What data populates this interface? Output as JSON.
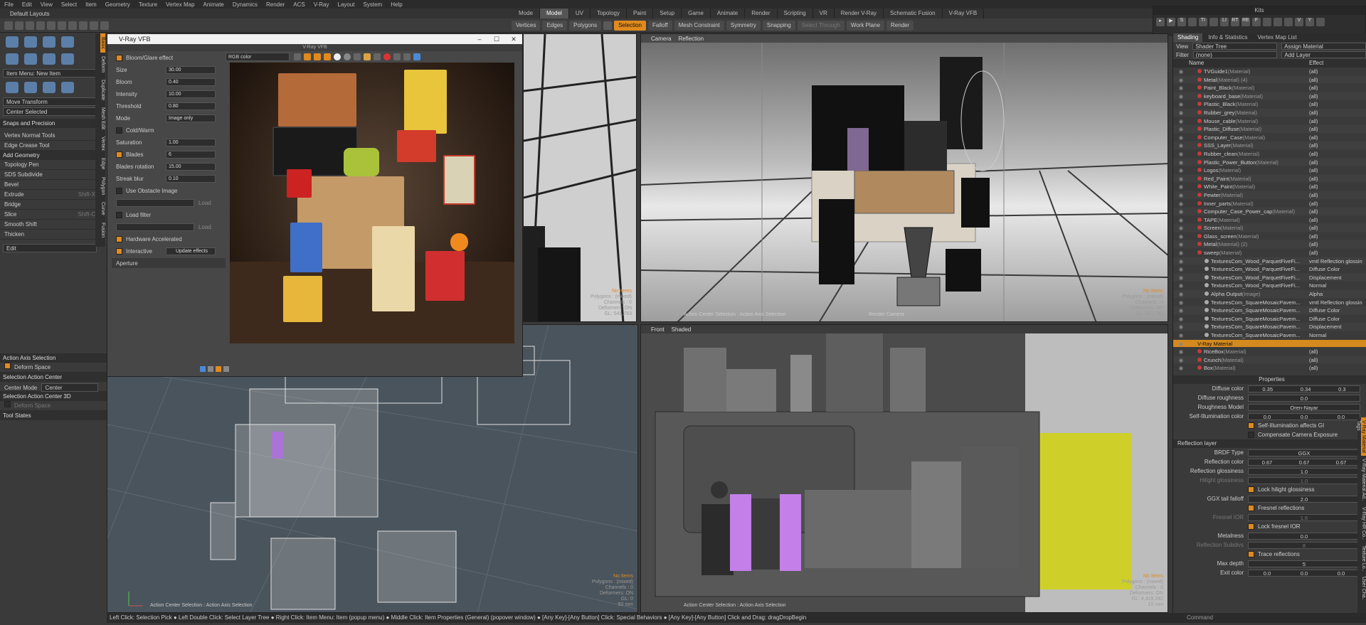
{
  "menu": [
    "File",
    "Edit",
    "View",
    "Select",
    "Item",
    "Geometry",
    "Texture",
    "Vertex Map",
    "Animate",
    "Dynamics",
    "Render",
    "ACS",
    "V-Ray",
    "Layout",
    "System",
    "Help"
  ],
  "layout_label": "Default Layouts",
  "layout_tabs": [
    "Mode",
    "Model",
    "UV",
    "Topology",
    "Paint",
    "Setup",
    "Game",
    "Animate",
    "Render",
    "Scripting",
    "VR",
    "Render V-Ray",
    "Schematic Fusion",
    "V-Ray VFB"
  ],
  "toolbar": {
    "vertices": "Vertices",
    "edges": "Edges",
    "polygons": "Polygons",
    "selection": "Selection",
    "falloff": "Falloff",
    "mesh_constraint": "Mesh Constraint",
    "symmetry": "Symmetry",
    "snapping": "Snapping",
    "select_through": "Select Through",
    "work_plane": "Work Plane",
    "render": "Render"
  },
  "kits": {
    "title": "Kits"
  },
  "left": {
    "item_menu": "Item Menu: New Item",
    "move_transform": "Move Transform",
    "center_selected": "Center Selected",
    "snaps": "Snaps and Precision",
    "vertex_normal": "Vertex Normal Tools",
    "edge_crease": "Edge Crease Tool",
    "add_geometry": "Add Geometry",
    "tools": [
      {
        "name": "Topology Pen",
        "key": ""
      },
      {
        "name": "SDS Subdivide",
        "key": ""
      },
      {
        "name": "Bevel",
        "key": ""
      },
      {
        "name": "Extrude",
        "key": "Shift-X"
      },
      {
        "name": "Bridge",
        "key": ""
      },
      {
        "name": "Slice",
        "key": "Shift-C"
      },
      {
        "name": "Smooth Shift",
        "key": ""
      },
      {
        "name": "Thicken",
        "key": ""
      }
    ],
    "edit": "Edit",
    "action_axis": "Action Axis Selection",
    "deform_space": "Deform Space",
    "sel_action_center": "Selection Action Center",
    "center_mode_label": "Center Mode",
    "center_mode_value": "Center",
    "sel_action_center_3d": "Selection Action Center 3D",
    "deform_space2": "Deform Space",
    "tool_states": "Tool States"
  },
  "sidetabs": [
    "Basic",
    "Deform",
    "Duplicate",
    "Mesh Edit",
    "Vertex",
    "Edge",
    "Polygon",
    "Curve",
    "Fusion"
  ],
  "vfb": {
    "window_title": "V-Ray VFB",
    "sub_title": "V-Ray VFB",
    "channel": "RGB color",
    "bloom_label": "Bloom/Glare effect",
    "size_label": "Size",
    "size": "30.00",
    "bloom": "Bloom",
    "bloom_val": "0.40",
    "intensity": "Intensity",
    "intensity_val": "10.00",
    "threshold": "Threshold",
    "threshold_val": "0.80",
    "mode": "Mode",
    "mode_val": "Image only",
    "cold_warm": "Cold/Warm",
    "saturation": "Saturation",
    "saturation_val": "1.00",
    "blades": "Blades",
    "blades_val": "6",
    "blades_rot": "Blades rotation",
    "blades_rot_val": "15.00",
    "streak": "Streak blur",
    "streak_val": "0.10",
    "obstacle": "Use Obstacle Image",
    "load": "Load",
    "load_filter": "Load filter",
    "load2": "Load",
    "hw": "Hardware Accelerated",
    "interactive": "Interactive",
    "update_effects": "Update effects",
    "aperture": "Aperture"
  },
  "vp_tl": {
    "info": [
      "No Items",
      "Polygons : (mixed)",
      "Channels : 0",
      "Deformers: ON",
      "GL: 541,783"
    ]
  },
  "vp_tr": {
    "camera": "Camera",
    "reflection": "Reflection",
    "info": [
      "No Items",
      "Polygons : (mixed)",
      "Channels : 0",
      "Deformers: ON",
      "GL: 541,783"
    ],
    "bottom": "Action Center Selection : Action Axis Selection",
    "render_camera": "Render Camera"
  },
  "vp_bl": {
    "info": [
      "No Items",
      "Polygons : (mixed)",
      "Channels : 0",
      "Deformers: ON",
      "GL: 0",
      "50 mm"
    ],
    "bottom": "Action Center Selection : Action Axis Selection"
  },
  "vp_br": {
    "front": "Front",
    "shaded": "Shaded",
    "info": [
      "No Items",
      "Polygons : (mixed)",
      "Channels : 0",
      "Deformers: ON",
      "GL: 4,419,242",
      "10 mm"
    ],
    "bottom": "Action Center Selection : Action Axis Selection"
  },
  "right": {
    "tabs": [
      "Shading",
      "Info & Statistics",
      "Vertex Map List"
    ],
    "view_label": "View",
    "view_value": "Shader Tree",
    "assign": "Assign Material",
    "filter_label": "Filter",
    "filter_value": "(none)",
    "add_layer": "Add Layer",
    "col_name": "Name",
    "col_effect": "Effect",
    "rows": [
      {
        "n": "TVGuide1",
        "t": "(Material)",
        "e": "(all)",
        "k": "r"
      },
      {
        "n": "Metal",
        "t": "(Material) (4)",
        "e": "(all)",
        "k": "r"
      },
      {
        "n": "Paint_Black",
        "t": "(Material)",
        "e": "(all)",
        "k": "r"
      },
      {
        "n": "keyboard_base",
        "t": "(Material)",
        "e": "(all)",
        "k": "r"
      },
      {
        "n": "Plastic_Black",
        "t": "(Material)",
        "e": "(all)",
        "k": "r"
      },
      {
        "n": "Rubber_grey",
        "t": "(Material)",
        "e": "(all)",
        "k": "r"
      },
      {
        "n": "Mouse_cable",
        "t": "(Material)",
        "e": "(all)",
        "k": "r"
      },
      {
        "n": "Plastic_Diffuse",
        "t": "(Material)",
        "e": "(all)",
        "k": "r"
      },
      {
        "n": "Computer_Case",
        "t": "(Material)",
        "e": "(all)",
        "k": "r"
      },
      {
        "n": "SSS_Layer",
        "t": "(Material)",
        "e": "(all)",
        "k": "r"
      },
      {
        "n": "Rubber_clean",
        "t": "(Material)",
        "e": "(all)",
        "k": "r"
      },
      {
        "n": "Plastic_Power_Button",
        "t": "(Material)",
        "e": "(all)",
        "k": "r"
      },
      {
        "n": "Logos",
        "t": "(Material)",
        "e": "(all)",
        "k": "r"
      },
      {
        "n": "Red_Paint",
        "t": "(Material)",
        "e": "(all)",
        "k": "r"
      },
      {
        "n": "White_Paint",
        "t": "(Material)",
        "e": "(all)",
        "k": "r"
      },
      {
        "n": "Pewter",
        "t": "(Material)",
        "e": "(all)",
        "k": "r"
      },
      {
        "n": "Inner_parts",
        "t": "(Material)",
        "e": "(all)",
        "k": "r"
      },
      {
        "n": "Computer_Case_Power_cap",
        "t": "(Material)",
        "e": "(all)",
        "k": "r"
      },
      {
        "n": "TAPE",
        "t": "(Material)",
        "e": "(all)",
        "k": "r"
      },
      {
        "n": "Screen",
        "t": "(Material)",
        "e": "(all)",
        "k": "r"
      },
      {
        "n": "Glass_screen",
        "t": "(Material)",
        "e": "(all)",
        "k": "r"
      },
      {
        "n": "Metal",
        "t": "(Material) (2)",
        "e": "(all)",
        "k": "r"
      },
      {
        "n": "sweep",
        "t": "(Material)",
        "e": "(all)",
        "k": "r"
      },
      {
        "n": "TexturesCom_Wood_ParquetFiveFi...",
        "t": "",
        "e": "vmtl Reflection glossin",
        "k": "g"
      },
      {
        "n": "TexturesCom_Wood_ParquetFiveFi...",
        "t": "",
        "e": "Diffuse Color",
        "k": "g"
      },
      {
        "n": "TexturesCom_Wood_ParquetFiveFi...",
        "t": "",
        "e": "Displacement",
        "k": "g"
      },
      {
        "n": "TexturesCom_Wood_ParquetFiveFi...",
        "t": "",
        "e": "Normal",
        "k": "g"
      },
      {
        "n": "Alpha Output",
        "t": "(Image)",
        "e": "Alpha",
        "k": "g"
      },
      {
        "n": "TexturesCom_SquareMosaicPavem...",
        "t": "",
        "e": "vmtl Reflection glossin",
        "k": "g"
      },
      {
        "n": "TexturesCom_SquareMosaicPavem...",
        "t": "",
        "e": "Diffuse Color",
        "k": "g"
      },
      {
        "n": "TexturesCom_SquareMosaicPavem...",
        "t": "",
        "e": "Diffuse Color",
        "k": "g"
      },
      {
        "n": "TexturesCom_SquareMosaicPavem...",
        "t": "",
        "e": "Displacement",
        "k": "g"
      },
      {
        "n": "TexturesCom_SquareMosaicPavem...",
        "t": "",
        "e": "Normal",
        "k": "g"
      },
      {
        "n": "V-Ray Material",
        "t": "",
        "e": "",
        "k": "sel"
      },
      {
        "n": "RiceBox",
        "t": "(Material)",
        "e": "(all)",
        "k": "r"
      },
      {
        "n": "Crunch",
        "t": "(Material)",
        "e": "(all)",
        "k": "r"
      },
      {
        "n": "Box",
        "t": "(Material)",
        "e": "(all)",
        "k": "r"
      }
    ],
    "properties": "Properties",
    "props": [
      {
        "l": "Diffuse color",
        "v": [
          "0.35",
          "0.34",
          "0.3"
        ]
      },
      {
        "l": "Diffuse roughness",
        "v": [
          "0.0"
        ]
      },
      {
        "l": "Roughness Model",
        "v": [
          "Oren-Nayar"
        ]
      },
      {
        "l": "Self-Illumination color",
        "v": [
          "0.0",
          "0.0",
          "0.0"
        ]
      }
    ],
    "self_illum_gi": "Self-Illumination affects GI",
    "comp_camera": "Compensate Camera Exposure",
    "refl_layer": "Reflection layer",
    "props2": [
      {
        "l": "BRDF Type",
        "v": [
          "GGX"
        ]
      },
      {
        "l": "Reflection color",
        "v": [
          "0.67",
          "0.67",
          "0.67"
        ]
      },
      {
        "l": "Reflection glossiness",
        "v": [
          "1.0"
        ]
      },
      {
        "l": "Hilight glossiness",
        "v": [
          "1.0"
        ]
      }
    ],
    "lock_hilight": "Lock hilight glossiness",
    "ggx_label": "GGX tail falloff",
    "ggx_val": "2.0",
    "fresnel": "Fresnel reflections",
    "fresnel_ior": "Fresnel IOR",
    "fresnel_ior_val": "1.6",
    "lock_fresnel": "Lock fresnel IOR",
    "metalness": "Metalness",
    "metalness_val": "0.0",
    "refl_subdivs": "Reflection Subdivs",
    "refl_subdivs_val": "8",
    "trace": "Trace reflections",
    "max_depth": "Max depth",
    "max_depth_val": "5",
    "exit_color": "Exit color",
    "exit_vals": [
      "0.0",
      "0.0",
      "0.0"
    ],
    "sidetabs": [
      "V-Ray Material",
      "V-Ray Material Ad..",
      "V-Ray HR Co..",
      "Texture Lo..",
      "User Cha..",
      "Tags"
    ]
  },
  "status": "Left Click: Selection Pick ● Left Double Click: Select Layer Tree ● Right Click: Item Menu: Item (popup menu) ● Middle Click: Item Properties (General) (popover window) ● [Any Key]-[Any Button] Click: Special Behaviors ● [Any Key]-[Any Button] Click and Drag: dragDropBegin",
  "command": "Command"
}
